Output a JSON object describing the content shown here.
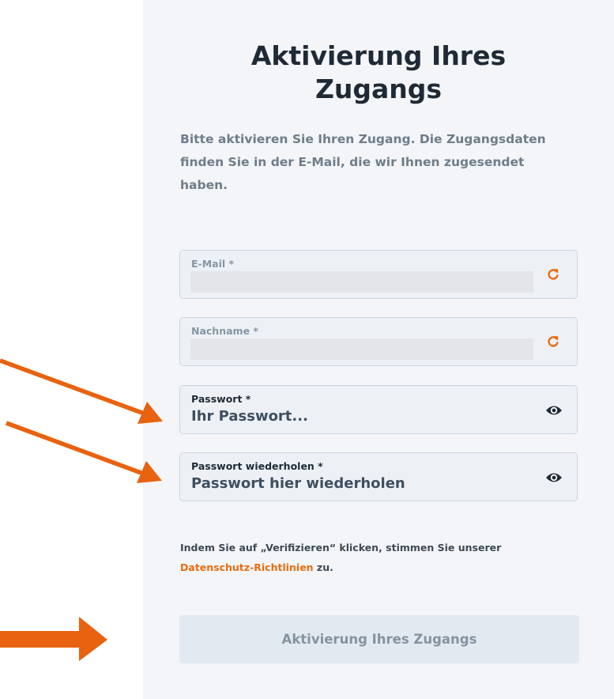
{
  "form": {
    "title_line1": "Aktivierung Ihres",
    "title_line2": "Zugangs",
    "subtitle": "Bitte aktivieren Sie Ihren Zugang. Die Zugangsdaten finden Sie in der E-Mail, die wir Ihnen zugesendet haben.",
    "fields": {
      "email": {
        "label": "E-Mail *",
        "value": "",
        "icon": "refresh-icon"
      },
      "lastname": {
        "label": "Nachname *",
        "value": "",
        "icon": "refresh-icon"
      },
      "password": {
        "label": "Passwort *",
        "placeholder": "Ihr Passwort...",
        "icon": "eye-icon"
      },
      "password_repeat": {
        "label": "Passwort wiederholen *",
        "placeholder": "Passwort hier wiederholen",
        "icon": "eye-icon"
      }
    },
    "consent": {
      "prefix": "Indem Sie auf „Verifizieren“ klicken, stimmen Sie unserer",
      "link": "Datenschutz-Richtlinien",
      "suffix": " zu."
    },
    "submit_label": "Aktivierung Ihres Zugangs"
  },
  "annotations": {
    "arrow_color": "#e8620f",
    "arrows": [
      "pointer-arrow-password",
      "pointer-arrow-password-repeat",
      "pointer-arrow-submit"
    ]
  },
  "colors": {
    "accent": "#ea6c10",
    "panel_background": "#f3f5f8",
    "heading": "#1f2a36",
    "muted_text": "#6f7d8a"
  }
}
